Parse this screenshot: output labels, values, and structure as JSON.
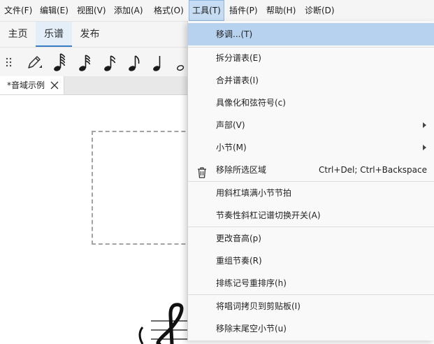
{
  "menubar": {
    "items": [
      {
        "label": "文件(F)"
      },
      {
        "label": "编辑(E)"
      },
      {
        "label": "视图(V)"
      },
      {
        "label": "添加(A)"
      },
      {
        "label": "格式(O)"
      },
      {
        "label": "工具(T)"
      },
      {
        "label": "插件(P)"
      },
      {
        "label": "帮助(H)"
      },
      {
        "label": "诊断(D)"
      }
    ],
    "active_item": "工具(T)"
  },
  "tabs": [
    {
      "label": "主页"
    },
    {
      "label": "乐谱"
    },
    {
      "label": "发布"
    }
  ],
  "active_tab": "乐谱",
  "toolbar": {
    "icons": [
      "drag-handle-icon",
      "pencil-icon",
      "64th-note-icon",
      "32nd-note-icon",
      "16th-note-icon",
      "eighth-note-icon",
      "quarter-note-icon",
      "half-note-icon"
    ]
  },
  "document": {
    "tab_label": "*音域示例",
    "close_icon": "close-icon"
  },
  "tools_menu": {
    "items": [
      {
        "label": "移调...(T)",
        "shortcut": "",
        "submenu": false,
        "highlighted": true
      },
      {
        "label": "拆分谱表(E)",
        "shortcut": "",
        "submenu": false
      },
      {
        "label": "合并谱表(I)",
        "shortcut": "",
        "submenu": false
      },
      {
        "label": "具像化和弦符号(c)",
        "shortcut": "",
        "submenu": false
      },
      {
        "label": "声部(V)",
        "shortcut": "",
        "submenu": true
      },
      {
        "label": "小节(M)",
        "shortcut": "",
        "submenu": true
      },
      {
        "label": "移除所选区域",
        "shortcut": "Ctrl+Del; Ctrl+Backspace",
        "submenu": false,
        "icon": "trash-icon"
      },
      {
        "label": "用斜杠填满小节节拍",
        "shortcut": "",
        "submenu": false
      },
      {
        "label": "节奏性斜杠记谱切换开关(A)",
        "shortcut": "",
        "submenu": false
      },
      {
        "label": "更改音高(p)",
        "shortcut": "",
        "submenu": false
      },
      {
        "label": "重组节奏(R)",
        "shortcut": "",
        "submenu": false
      },
      {
        "label": "排练记号重排序(h)",
        "shortcut": "",
        "submenu": false
      },
      {
        "label": "将唱词拷贝到剪贴板(I)",
        "shortcut": "",
        "submenu": false
      },
      {
        "label": "移除末尾空小节(u)",
        "shortcut": "",
        "submenu": false
      }
    ]
  },
  "colors": {
    "accent": "#3a7dc4",
    "menu_highlight": "#b6d2ee",
    "active_menu_bg": "#c6dcf2"
  }
}
